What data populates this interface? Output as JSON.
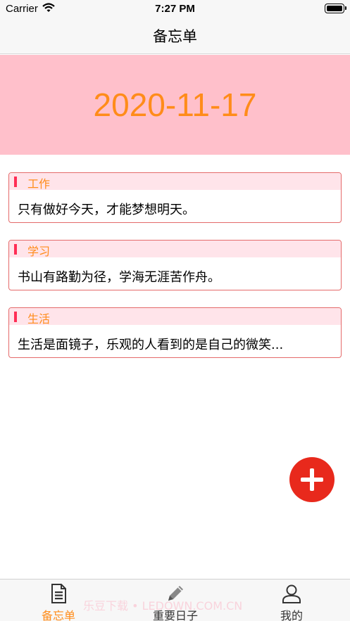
{
  "status_bar": {
    "carrier": "Carrier",
    "time": "7:27 PM"
  },
  "nav": {
    "title": "备忘单"
  },
  "banner": {
    "date": "2020-11-17"
  },
  "cards": [
    {
      "category": "工作",
      "text": "只有做好今天，才能梦想明天。"
    },
    {
      "category": "学习",
      "text": "书山有路勤为径，学海无涯苦作舟。"
    },
    {
      "category": "生活",
      "text": "生活是面镜子，乐观的人看到的是自己的微笑..."
    }
  ],
  "tabs": [
    {
      "label": "备忘单",
      "icon": "memo-icon",
      "active": true
    },
    {
      "label": "重要日子",
      "icon": "pencil-icon",
      "active": false
    },
    {
      "label": "我的",
      "icon": "person-icon",
      "active": false
    }
  ],
  "watermark": "乐豆下载 • LEDOWN.COM.CN",
  "colors": {
    "banner": "#ffc0cb",
    "accent": "#ff8c1a",
    "card_border": "#e46a6a",
    "card_header": "#ffe4ea",
    "marker": "#ff2d55",
    "fab": "#e8291c"
  }
}
